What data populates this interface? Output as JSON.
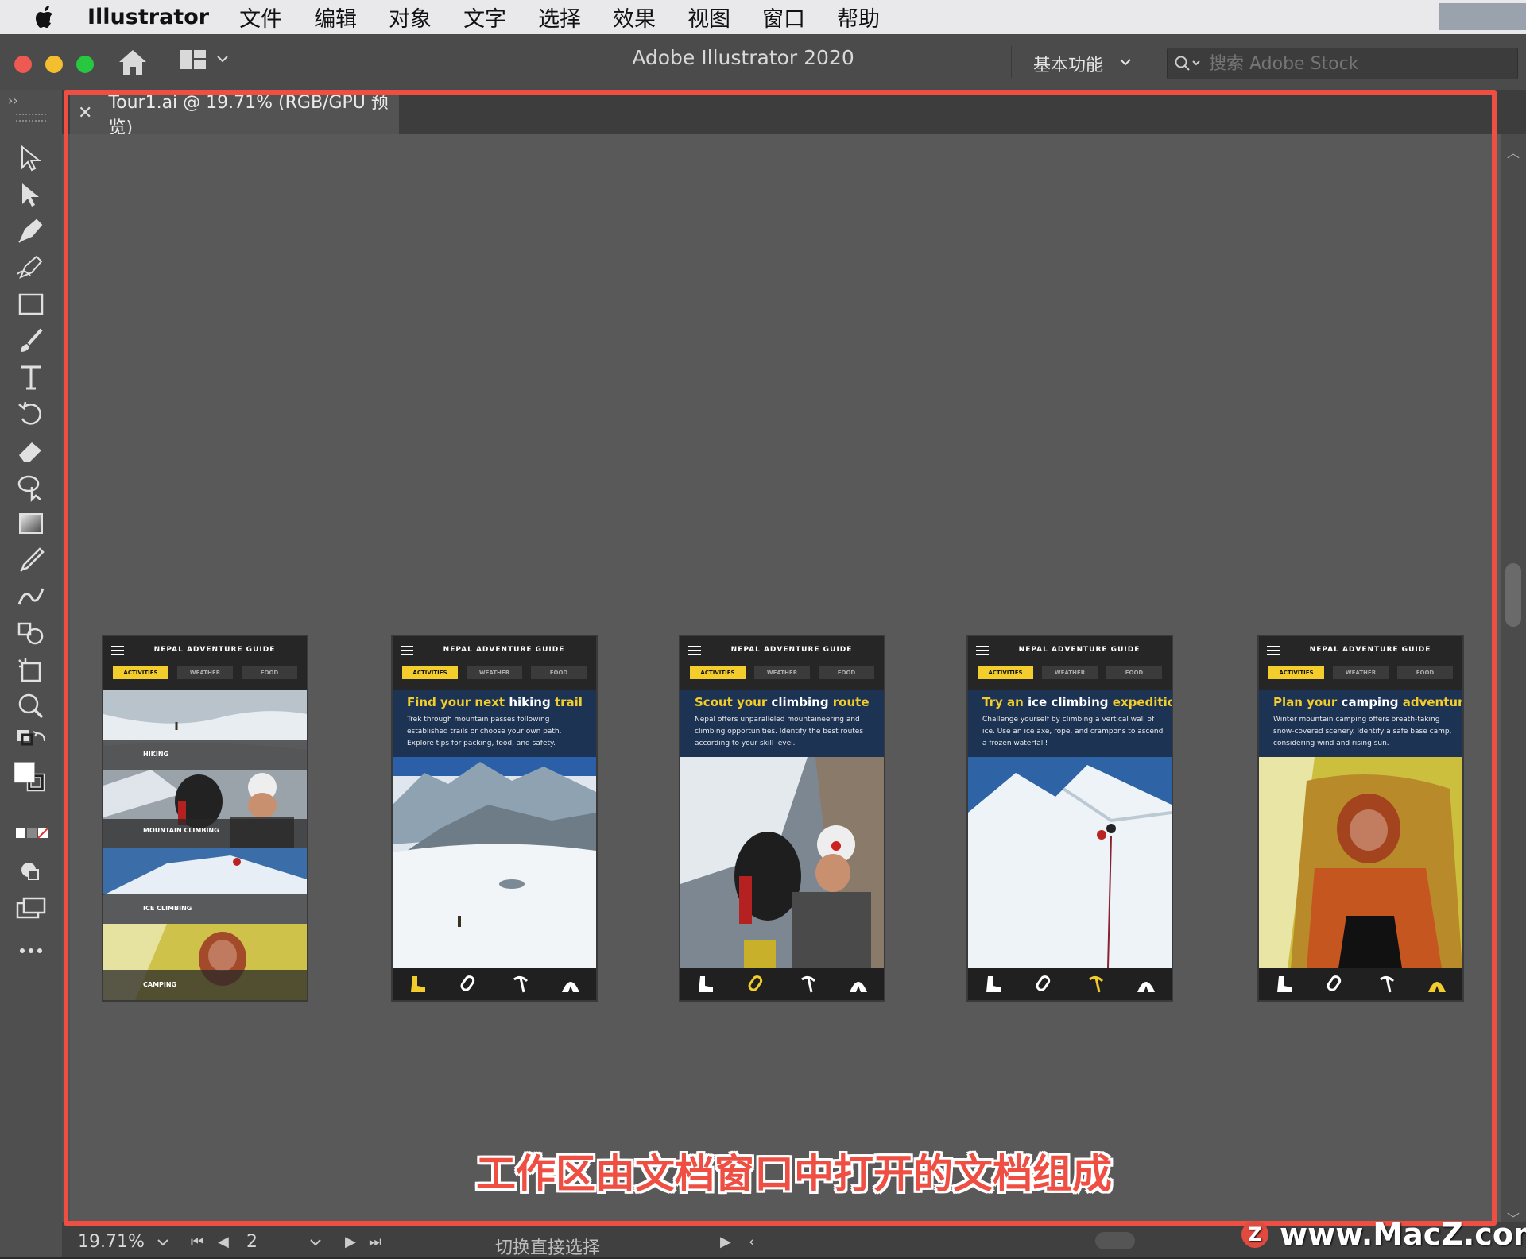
{
  "menubar": {
    "app_name": "Illustrator",
    "items": [
      "文件",
      "编辑",
      "对象",
      "文字",
      "选择",
      "效果",
      "视图",
      "窗口",
      "帮助"
    ]
  },
  "window": {
    "title": "Adobe Illustrator 2020",
    "workspace": "基本功能",
    "stock_search_placeholder": "搜索 Adobe Stock"
  },
  "document": {
    "tab_label": "Tour1.ai @ 19.71% (RGB/GPU 预览)"
  },
  "artboards": {
    "guide_title": "NEPAL ADVENTURE GUIDE",
    "tabs": [
      "ACTIVITIES",
      "WEATHER",
      "FOOD"
    ],
    "overview_labels": [
      "HIKING",
      "MOUNTAIN CLIMBING",
      "ICE CLIMBING",
      "CAMPING"
    ],
    "screens": [
      {
        "title_parts": [
          {
            "t": "Find your next ",
            "y": true
          },
          {
            "t": "hiking",
            "y": false
          },
          {
            "t": " trail",
            "y": true
          }
        ],
        "desc": "Trek through mountain passes following established trails or choose your own path. Explore tips for packing, food, and safety.",
        "active_icon": 0
      },
      {
        "title_parts": [
          {
            "t": "Scout your ",
            "y": true
          },
          {
            "t": "climbing",
            "y": false
          },
          {
            "t": " route",
            "y": true
          }
        ],
        "desc": "Nepal offers unparalleled mountaineering and climbing opportunities. Identify the best routes according to your skill level.",
        "active_icon": 1
      },
      {
        "title_parts": [
          {
            "t": "Try an ",
            "y": true
          },
          {
            "t": "ice climbing",
            "y": false
          },
          {
            "t": " expedition",
            "y": true
          }
        ],
        "desc": "Challenge yourself by climbing a vertical wall of ice. Use an ice axe, rope, and crampons to ascend a frozen waterfall!",
        "active_icon": 2
      },
      {
        "title_parts": [
          {
            "t": "Plan your ",
            "y": true
          },
          {
            "t": "camping",
            "y": false
          },
          {
            "t": " adventure",
            "y": true
          }
        ],
        "desc": "Winter mountain camping offers breath-taking snow-covered scenery. Identify a safe base camp, considering wind and rising sun.",
        "active_icon": 3
      }
    ]
  },
  "statusbar": {
    "zoom": "19.71%",
    "artboard_number": "2",
    "tool_hint": "切换直接选择"
  },
  "caption": "工作区由文档窗口中打开的文档组成",
  "watermark": "www.MacZ.com",
  "colors": {
    "accent_yellow": "#f2cd2c",
    "highlight_red": "#ef4e43",
    "canvas_gray": "#595959"
  }
}
